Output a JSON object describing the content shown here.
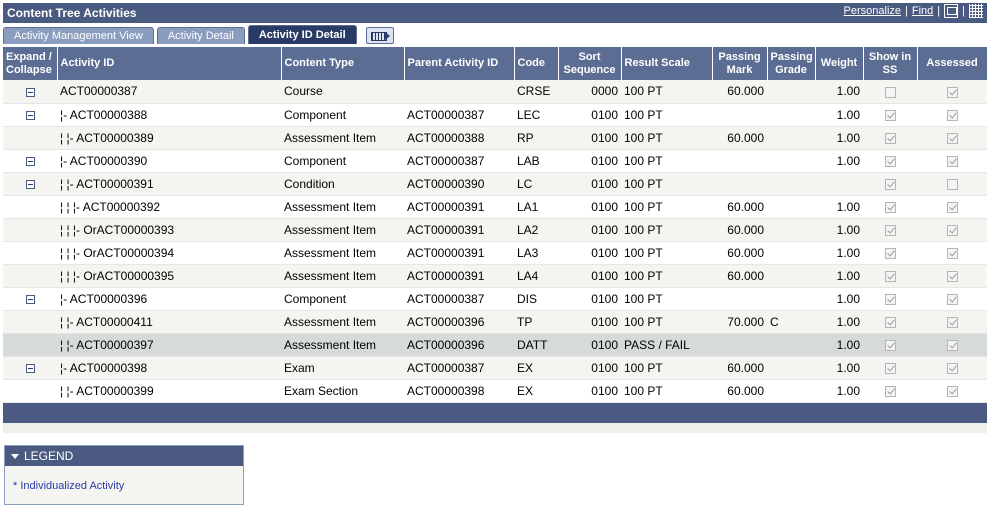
{
  "header": {
    "title": "Content Tree Activities",
    "personalize": "Personalize",
    "find": "Find",
    "sep": "|"
  },
  "tabs": [
    {
      "label": "Activity Management View",
      "active": false
    },
    {
      "label": "Activity Detail",
      "active": false
    },
    {
      "label": "Activity ID Detail",
      "active": true
    }
  ],
  "columns": {
    "expand": "Expand / Collapse",
    "activity_id": "Activity ID",
    "content_type": "Content Type",
    "parent_id": "Parent Activity ID",
    "code": "Code",
    "sort_seq": "Sort Sequence",
    "result_scale": "Result Scale",
    "passing_mark": "Passing Mark",
    "passing_grade": "Passing Grade",
    "weight": "Weight",
    "show_ss": "Show in SS",
    "assessed": "Assessed"
  },
  "rows": [
    {
      "expand": true,
      "activity": "ACT00000387",
      "type": "Course",
      "parent": "",
      "code": "CRSE",
      "sort": "0000",
      "scale": "100 PT",
      "mark": "60.000",
      "grade": "",
      "weight": "1.00",
      "show": false,
      "assessed": true
    },
    {
      "expand": true,
      "activity": "¦-  ACT00000388",
      "type": "Component",
      "parent": "ACT00000387",
      "code": "LEC",
      "sort": "0100",
      "scale": "100 PT",
      "mark": "",
      "grade": "",
      "weight": "1.00",
      "show": true,
      "assessed": true
    },
    {
      "expand": false,
      "activity": "¦    ¦-  ACT00000389",
      "type": "Assessment Item",
      "parent": "ACT00000388",
      "code": "RP",
      "sort": "0100",
      "scale": "100 PT",
      "mark": "60.000",
      "grade": "",
      "weight": "1.00",
      "show": true,
      "assessed": true
    },
    {
      "expand": true,
      "activity": "¦-  ACT00000390",
      "type": "Component",
      "parent": "ACT00000387",
      "code": "LAB",
      "sort": "0100",
      "scale": "100 PT",
      "mark": "",
      "grade": "",
      "weight": "1.00",
      "show": true,
      "assessed": true
    },
    {
      "expand": true,
      "activity": "¦    ¦-  ACT00000391",
      "type": "Condition",
      "parent": "ACT00000390",
      "code": "LC",
      "sort": "0100",
      "scale": "100 PT",
      "mark": "",
      "grade": "",
      "weight": "",
      "show": true,
      "assessed": false
    },
    {
      "expand": false,
      "activity": "¦    ¦    ¦-  ACT00000392",
      "type": "Assessment Item",
      "parent": "ACT00000391",
      "code": "LA1",
      "sort": "0100",
      "scale": "100 PT",
      "mark": "60.000",
      "grade": "",
      "weight": "1.00",
      "show": true,
      "assessed": true
    },
    {
      "expand": false,
      "activity": "¦    ¦    ¦-  OrACT00000393",
      "type": "Assessment Item",
      "parent": "ACT00000391",
      "code": "LA2",
      "sort": "0100",
      "scale": "100 PT",
      "mark": "60.000",
      "grade": "",
      "weight": "1.00",
      "show": true,
      "assessed": true
    },
    {
      "expand": false,
      "activity": "¦    ¦    ¦-  OrACT00000394",
      "type": "Assessment Item",
      "parent": "ACT00000391",
      "code": "LA3",
      "sort": "0100",
      "scale": "100 PT",
      "mark": "60.000",
      "grade": "",
      "weight": "1.00",
      "show": true,
      "assessed": true
    },
    {
      "expand": false,
      "activity": "¦    ¦    ¦-  OrACT00000395",
      "type": "Assessment Item",
      "parent": "ACT00000391",
      "code": "LA4",
      "sort": "0100",
      "scale": "100 PT",
      "mark": "60.000",
      "grade": "",
      "weight": "1.00",
      "show": true,
      "assessed": true
    },
    {
      "expand": true,
      "activity": "¦-  ACT00000396",
      "type": "Component",
      "parent": "ACT00000387",
      "code": "DIS",
      "sort": "0100",
      "scale": "100 PT",
      "mark": "",
      "grade": "",
      "weight": "1.00",
      "show": true,
      "assessed": true
    },
    {
      "expand": false,
      "activity": "¦    ¦-  ACT00000411",
      "type": "Assessment Item",
      "parent": "ACT00000396",
      "code": "TP",
      "sort": "0100",
      "scale": "100 PT",
      "mark": "70.000",
      "grade": "C",
      "weight": "1.00",
      "show": true,
      "assessed": true
    },
    {
      "expand": false,
      "activity": "¦    ¦-  ACT00000397",
      "type": "Assessment Item",
      "parent": "ACT00000396",
      "code": "DATT",
      "sort": "0100",
      "scale": "PASS / FAIL",
      "mark": "",
      "grade": "",
      "weight": "1.00",
      "show": true,
      "assessed": true
    },
    {
      "expand": true,
      "activity": "¦-  ACT00000398",
      "type": "Exam",
      "parent": "ACT00000387",
      "code": "EX",
      "sort": "0100",
      "scale": "100 PT",
      "mark": "60.000",
      "grade": "",
      "weight": "1.00",
      "show": true,
      "assessed": true
    },
    {
      "expand": false,
      "activity": "¦    ¦-  ACT00000399",
      "type": "Exam Section",
      "parent": "ACT00000398",
      "code": "EX",
      "sort": "0100",
      "scale": "100 PT",
      "mark": "60.000",
      "grade": "",
      "weight": "1.00",
      "show": true,
      "assessed": true
    }
  ],
  "highlight_row": 11,
  "legend": {
    "title": "LEGEND",
    "item": "* Individualized Activity"
  },
  "colors": {
    "header_bar": "#4a5a80",
    "column_header": "#5c6d93",
    "active_tab": "#2a3a66"
  }
}
